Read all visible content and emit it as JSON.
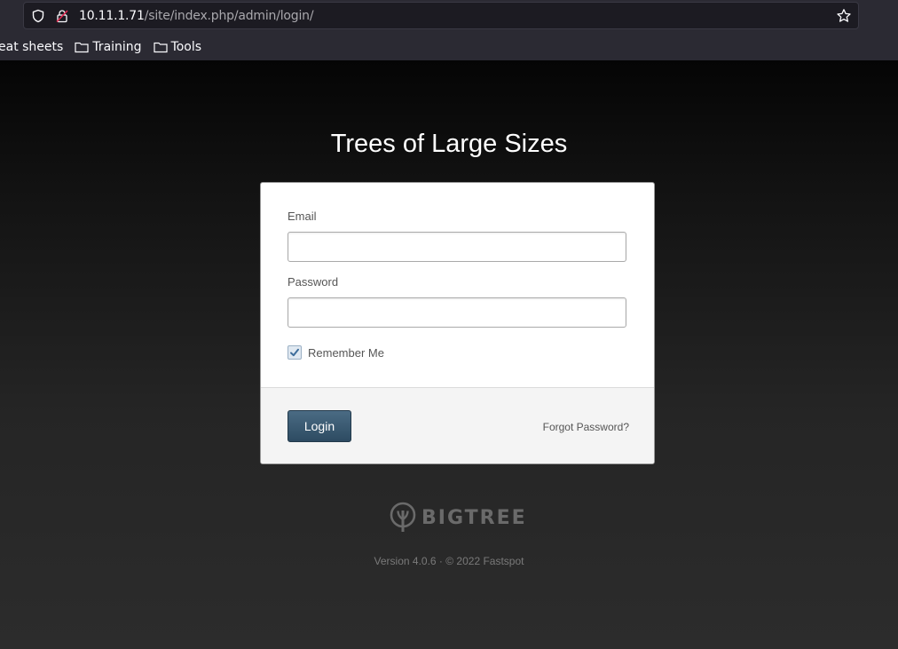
{
  "browser": {
    "url_host": "10.11.1.71",
    "url_path": "/site/index.php/admin/login/",
    "bookmarks": [
      {
        "label": "eat sheets"
      },
      {
        "label": "Training"
      },
      {
        "label": "Tools"
      }
    ],
    "icons": [
      "shield-icon",
      "lock-icon",
      "star-icon",
      "folder-icon"
    ]
  },
  "page": {
    "site_title": "Trees of Large Sizes",
    "email_label": "Email",
    "email_value": "",
    "password_label": "Password",
    "password_value": "",
    "remember_label": "Remember Me",
    "remember_checked": true,
    "login_label": "Login",
    "forgot_label": "Forgot Password?",
    "brand": "BIGTREE",
    "version": "Version 4.0.6 · © 2022 Fastspot"
  },
  "colors": {
    "button": "#2d4b62",
    "background_top": "#050505",
    "background_bottom": "#2c2c2c"
  }
}
